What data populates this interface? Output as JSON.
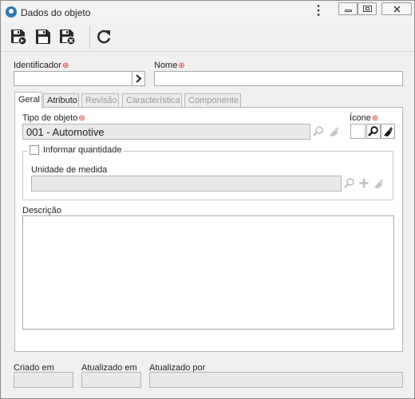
{
  "window": {
    "title": "Dados do objeto",
    "menu_icon": "kebab-menu-icon",
    "controls": [
      "minimize-icon",
      "restore-icon",
      "close-icon"
    ]
  },
  "toolbar": {
    "buttons": [
      {
        "name": "save-and-new-button",
        "icon": "save-new-icon"
      },
      {
        "name": "save-button",
        "icon": "save-icon"
      },
      {
        "name": "save-and-close-button",
        "icon": "save-close-icon"
      },
      {
        "name": "refresh-button",
        "icon": "refresh-icon"
      }
    ]
  },
  "header": {
    "identifier_label": "Identificador",
    "identifier_value": "",
    "name_label": "Nome",
    "name_value": ""
  },
  "tabs": [
    {
      "label": "Geral",
      "state": "active"
    },
    {
      "label": "Atributo",
      "state": "enabled"
    },
    {
      "label": "Revisão",
      "state": "disabled"
    },
    {
      "label": "Característica",
      "state": "disabled"
    },
    {
      "label": "Componente",
      "state": "disabled"
    }
  ],
  "general": {
    "object_type_label": "Tipo de objeto",
    "object_type_value": "001 - Automotive",
    "icon_label": "Ícone",
    "quantity_checkbox_label": "Informar quantidade",
    "quantity_checked": false,
    "unit_label": "Unidade de medida",
    "unit_value": "",
    "description_label": "Descrição",
    "description_value": ""
  },
  "footer": {
    "created_label": "Criado em",
    "updated_label": "Atualizado em",
    "updated_by_label": "Atualizado por",
    "created_value": "",
    "updated_value": "",
    "updated_by_value": ""
  },
  "colors": {
    "required_marker": "#d9252a",
    "toolbar_icon": "#2a2a2a",
    "app_icon": "#2b79b5"
  }
}
